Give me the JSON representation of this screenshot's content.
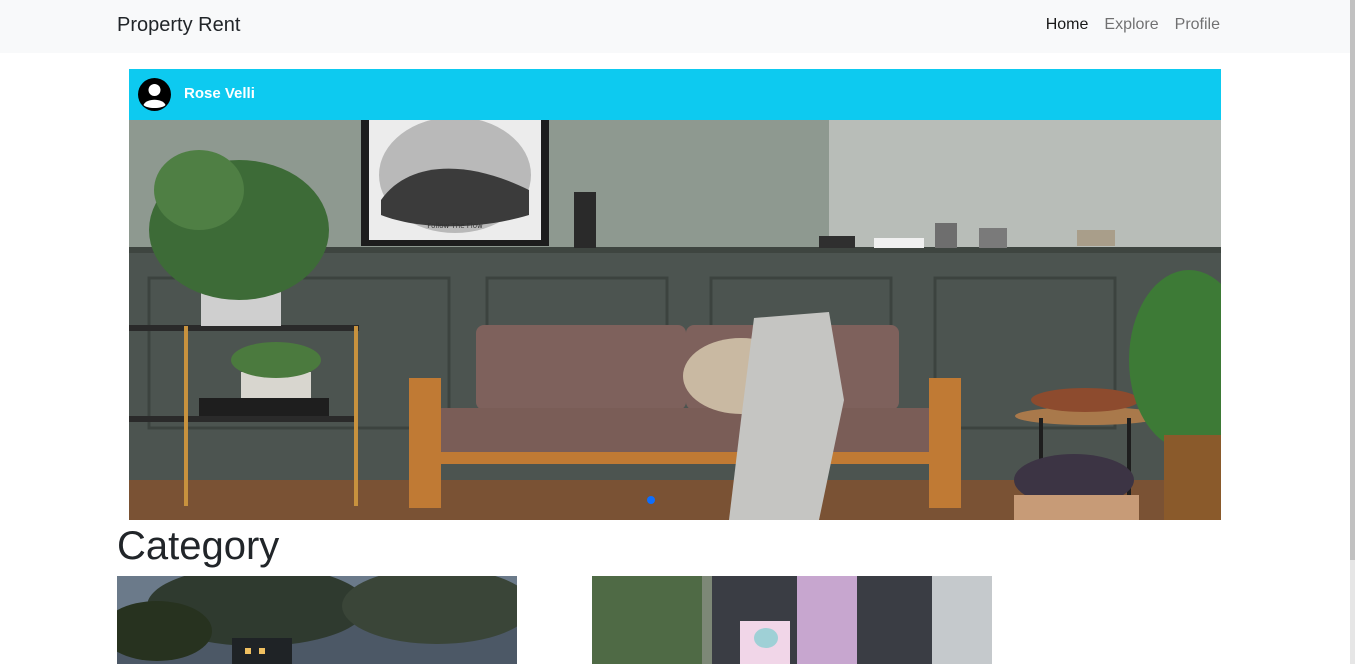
{
  "navbar": {
    "brand": "Property Rent",
    "links": [
      {
        "label": "Home",
        "active": true
      },
      {
        "label": "Explore",
        "active": false
      },
      {
        "label": "Profile",
        "active": false
      }
    ]
  },
  "carousel": {
    "owner_name": "Rose Velli",
    "owner_icon": "user-avatar-icon",
    "accent_color": "#0dcaf0",
    "slide_count_indicator_color": "#0d6efd",
    "poster_text": "Follow The Flow"
  },
  "category": {
    "title": "Category"
  }
}
